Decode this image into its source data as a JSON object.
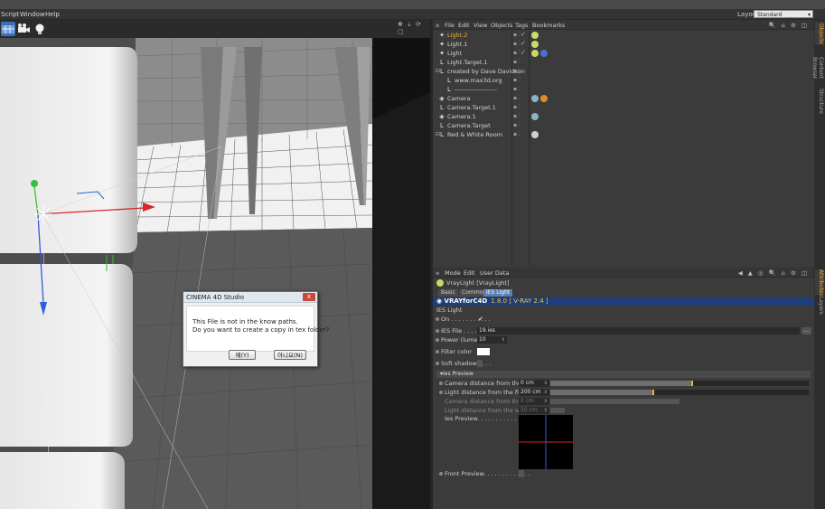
{
  "menubar": {
    "items": [
      "Script",
      "Window",
      "Help"
    ],
    "layout_label": "Layout:",
    "layout_value": "Standard"
  },
  "dialog": {
    "title": "CINEMA 4D Studio",
    "close": "x",
    "line1": "This File is not in the know paths.",
    "line2": "Do you want to create a copy in tex folder?",
    "yes_label": "예(Y)",
    "no_label": "아니요(N)"
  },
  "object_manager": {
    "menu": [
      "File",
      "Edit",
      "View",
      "Objects",
      "Tags",
      "Bookmarks"
    ],
    "rows": [
      {
        "name": "Light.2",
        "selected": true,
        "icon": "light-icon",
        "tags": [
          "vray-light-tag"
        ]
      },
      {
        "name": "Light.1",
        "selected": false,
        "icon": "light-icon",
        "tags": [
          "vray-light-tag"
        ]
      },
      {
        "name": "Light",
        "selected": false,
        "icon": "light-icon",
        "tags": [
          "vray-light-tag",
          "target-tag"
        ]
      },
      {
        "name": "Light.Target.1",
        "selected": false,
        "icon": "null-icon",
        "tags": []
      },
      {
        "name": "created by Dave Davidson",
        "selected": false,
        "icon": "null-icon",
        "tags": []
      },
      {
        "name": "www.max3d.org",
        "selected": false,
        "icon": "null-icon",
        "tags": []
      },
      {
        "name": "--------------------",
        "selected": false,
        "icon": "null-icon",
        "tags": []
      },
      {
        "name": "Camera",
        "selected": false,
        "icon": "camera-icon",
        "tags": [
          "camera-tag",
          "protection-tag"
        ]
      },
      {
        "name": "Camera.Target.1",
        "selected": false,
        "icon": "null-icon",
        "tags": []
      },
      {
        "name": "Camera.1",
        "selected": false,
        "icon": "camera-icon",
        "tags": [
          "camera-tag"
        ]
      },
      {
        "name": "Camera.Target",
        "selected": false,
        "icon": "null-icon",
        "tags": []
      },
      {
        "name": "Red & White Room",
        "selected": false,
        "icon": "null-icon",
        "tags": [
          "texture-tag"
        ]
      }
    ]
  },
  "side_tabs": [
    "Objects",
    "Content Browser",
    "Structure",
    "Attributes",
    "Layers"
  ],
  "attributes": {
    "menu": [
      "Mode",
      "Edit",
      "User Data"
    ],
    "object_name": "VrayLight [VrayLight]",
    "tabs": [
      "Basic",
      "Common",
      "IES Light"
    ],
    "active_tab": "IES Light",
    "banner_title": "VRAYforC4D",
    "banner_version": "1.8.0  [ V-RAY 2.4 ]",
    "section_title": "IES Light",
    "on_label": "On . . . . . . . . . . .",
    "on_value": "✔",
    "ies_file_label": "IES File . . . . . . . .",
    "ies_file_value": "19.ies",
    "power_label": "Power (lumens)",
    "power_value": "10",
    "filter_color_label": "Filter color",
    "filter_color": "#ffffff",
    "soft_shadows_label": "Soft shadows . . .",
    "ies_preview_header": "Ies Preview",
    "cam_floor_label": "Camera distance from the floor",
    "cam_floor_value": "0 cm",
    "cam_floor_fill": 0.55,
    "light_floor_label": "Light distance from the floor. . .",
    "light_floor_value": "200 cm",
    "light_floor_fill": 0.4,
    "cam_wall_label": "Camera distance from the wall",
    "cam_wall_value": "0 cm",
    "light_wall_label": "Light distance from the wall . . .",
    "light_wall_value": "50 cm",
    "ies_preview_label": "Ies Preview. . . . . . . . . . . . . . . . .",
    "front_preview_label": "Front Preview. . . . . . . . . . . . ."
  },
  "colors": {
    "selected": "#f2b33a",
    "banner": "#1e3d7a",
    "axis_x": "#d8262a",
    "axis_y": "#34c038",
    "axis_z": "#2a5fd6"
  }
}
